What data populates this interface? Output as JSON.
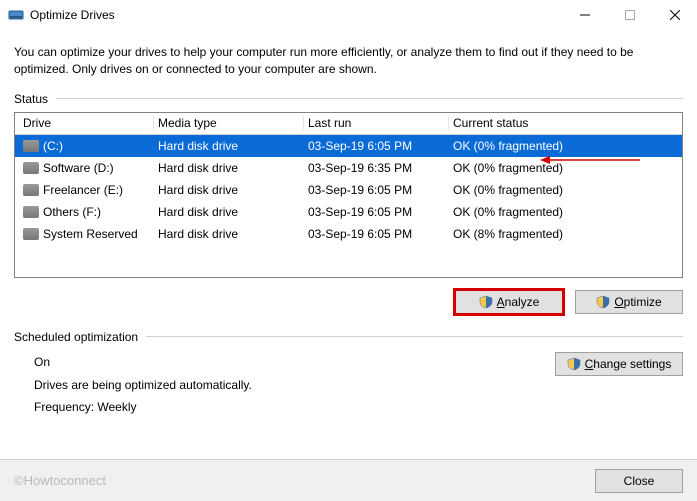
{
  "window": {
    "title": "Optimize Drives",
    "intro": "You can optimize your drives to help your computer run more efficiently, or analyze them to find out if they need to be optimized. Only drives on or connected to your computer are shown."
  },
  "status_label": "Status",
  "columns": {
    "drive": "Drive",
    "media": "Media type",
    "lastrun": "Last run",
    "status": "Current status"
  },
  "drives": [
    {
      "name": "(C:)",
      "media": "Hard disk drive",
      "lastrun": "03-Sep-19 6:05 PM",
      "status": "OK (0% fragmented)",
      "selected": true
    },
    {
      "name": "Software (D:)",
      "media": "Hard disk drive",
      "lastrun": "03-Sep-19 6:35 PM",
      "status": "OK (0% fragmented)",
      "selected": false
    },
    {
      "name": "Freelancer (E:)",
      "media": "Hard disk drive",
      "lastrun": "03-Sep-19 6:05 PM",
      "status": "OK (0% fragmented)",
      "selected": false
    },
    {
      "name": "Others (F:)",
      "media": "Hard disk drive",
      "lastrun": "03-Sep-19 6:05 PM",
      "status": "OK (0% fragmented)",
      "selected": false
    },
    {
      "name": "System Reserved",
      "media": "Hard disk drive",
      "lastrun": "03-Sep-19 6:05 PM",
      "status": "OK (8% fragmented)",
      "selected": false
    }
  ],
  "buttons": {
    "analyze_u": "A",
    "analyze_rest": "nalyze",
    "optimize_u": "O",
    "optimize_rest": "ptimize",
    "change_u": "C",
    "change_rest": "hange settings",
    "close": "Close"
  },
  "sched_label": "Scheduled optimization",
  "sched": {
    "state": "On",
    "desc": "Drives are being optimized automatically.",
    "freq": "Frequency: Weekly"
  },
  "watermark": "©Howtoconnect"
}
